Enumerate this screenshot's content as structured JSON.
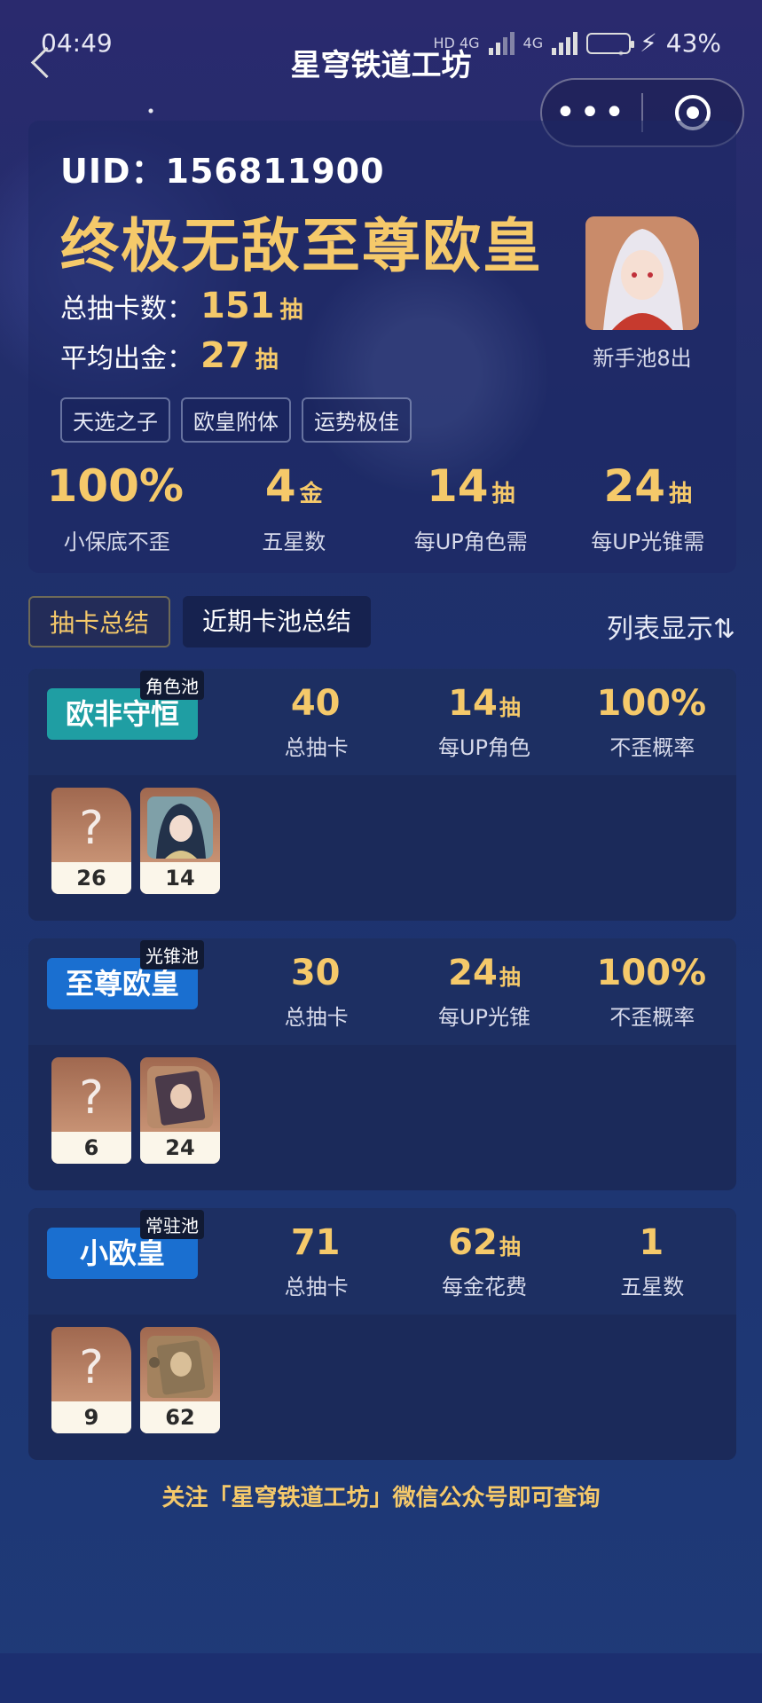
{
  "status": {
    "time": "04:49",
    "net1": "HD 4G",
    "net2": "4G",
    "battery": "43%"
  },
  "header": {
    "title": "星穹铁道工坊"
  },
  "profile": {
    "uid_label": "UID：",
    "uid": "156811900",
    "rank_title": "终极无敌至尊欧皇",
    "total_label": "总抽卡数：",
    "total_value": "151",
    "total_unit": "抽",
    "avg_label": "平均出金：",
    "avg_value": "27",
    "avg_unit": "抽",
    "avatar_caption": "新手池8出",
    "tags": [
      "天选之子",
      "欧皇附体",
      "运势极佳"
    ]
  },
  "top_stats": [
    {
      "value": "100%",
      "unit": "",
      "label": "小保底不歪"
    },
    {
      "value": "4",
      "unit": "金",
      "label": "五星数"
    },
    {
      "value": "14",
      "unit": "抽",
      "label": "每UP角色需"
    },
    {
      "value": "24",
      "unit": "抽",
      "label": "每UP光锥需"
    }
  ],
  "tabs": {
    "summary": "抽卡总结",
    "recent": "近期卡池总结",
    "list_toggle": "列表显示⇅"
  },
  "pools": [
    {
      "type": "角色池",
      "badge": "欧非守恒",
      "badge_color": "#1f9ea3",
      "stats": [
        {
          "value": "40",
          "unit": "",
          "label": "总抽卡"
        },
        {
          "value": "14",
          "unit": "抽",
          "label": "每UP角色"
        },
        {
          "value": "100%",
          "unit": "",
          "label": "不歪概率"
        }
      ],
      "pulls": [
        "26",
        "14"
      ]
    },
    {
      "type": "光锥池",
      "badge": "至尊欧皇",
      "badge_color": "#1a6fd0",
      "stats": [
        {
          "value": "30",
          "unit": "",
          "label": "总抽卡"
        },
        {
          "value": "24",
          "unit": "抽",
          "label": "每UP光锥"
        },
        {
          "value": "100%",
          "unit": "",
          "label": "不歪概率"
        }
      ],
      "pulls": [
        "6",
        "24"
      ]
    },
    {
      "type": "常驻池",
      "badge": "小欧皇",
      "badge_color": "#1a6fd0",
      "stats": [
        {
          "value": "71",
          "unit": "",
          "label": "总抽卡"
        },
        {
          "value": "62",
          "unit": "抽",
          "label": "每金花费"
        },
        {
          "value": "1",
          "unit": "",
          "label": "五星数"
        }
      ],
      "pulls": [
        "9",
        "62"
      ]
    }
  ],
  "pull_unknown_glyph": "?",
  "footer": "关注「星穹铁道工坊」微信公众号即可查询"
}
